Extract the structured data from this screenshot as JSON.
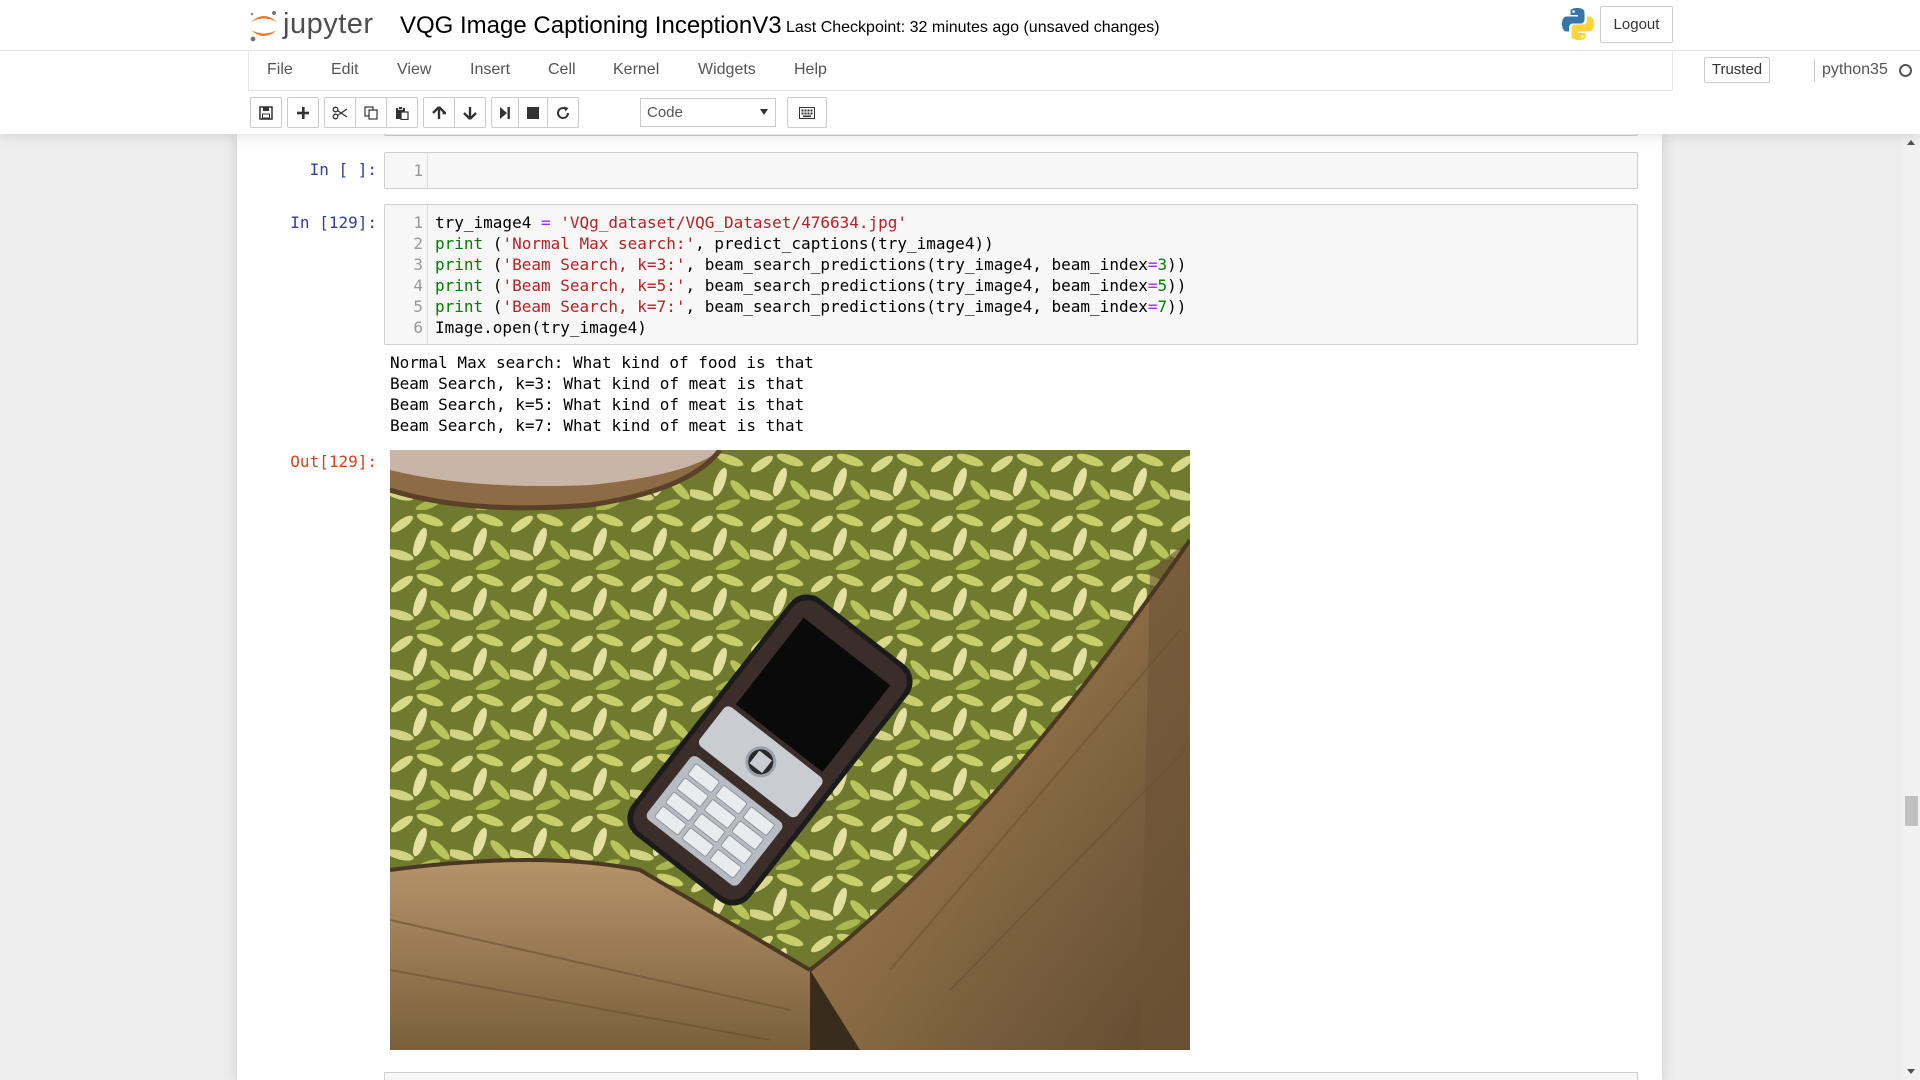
{
  "header": {
    "logo_text": "jupyter",
    "notebook_title": "VQG Image Captioning InceptionV3",
    "checkpoint": "Last Checkpoint: 32 minutes ago (unsaved changes)",
    "logout_label": "Logout"
  },
  "menubar": {
    "items": [
      "File",
      "Edit",
      "View",
      "Insert",
      "Cell",
      "Kernel",
      "Widgets",
      "Help"
    ],
    "trusted_label": "Trusted",
    "kernel_name": "python35"
  },
  "toolbar": {
    "cell_type": "Code",
    "buttons": [
      "save-icon",
      "plus-icon",
      "cut-icon",
      "copy-icon",
      "paste-icon",
      "arrow-up-icon",
      "arrow-down-icon",
      "run-icon",
      "stop-icon",
      "restart-icon",
      "keyboard-icon"
    ]
  },
  "cells": [
    {
      "prompt": "In [ ]:",
      "line_numbers": [
        "1"
      ]
    },
    {
      "prompt": "In [129]:",
      "line_numbers": [
        "1",
        "2",
        "3",
        "4",
        "5",
        "6"
      ],
      "code": {
        "l1_var": "try_image4 ",
        "l1_eq": "=",
        "l1_str": "'VQg_dataset/VQG_Dataset/476634.jpg'",
        "kw_print": "print",
        "l2_open": " (",
        "l2_str": "'Normal Max search:'",
        "l2_rest": ", predict_captions(try_image4))",
        "l3_str": "'Beam Search, k=3:'",
        "l4_str": "'Beam Search, k=5:'",
        "l5_str": "'Beam Search, k=7:'",
        "beam_call": ", beam_search_predictions(try_image4, beam_index",
        "eq": "=",
        "k3": "3",
        "k5": "5",
        "k7": "7",
        "close": "))",
        "l6": "Image.open(try_image4)"
      },
      "stdout": [
        "Normal Max search: What kind of food is that",
        "Beam Search, k=3: What kind of meat is that",
        "Beam Search, k=5: What kind of meat is that",
        "Beam Search, k=7: What kind of meat is that"
      ],
      "out_prompt": "Out[129]:"
    }
  ],
  "colors": {
    "prompt_in": "#303f9f",
    "prompt_out": "#d84315",
    "keyword": "#008000",
    "string": "#ba2121",
    "jupyter_orange": "#f37726"
  }
}
